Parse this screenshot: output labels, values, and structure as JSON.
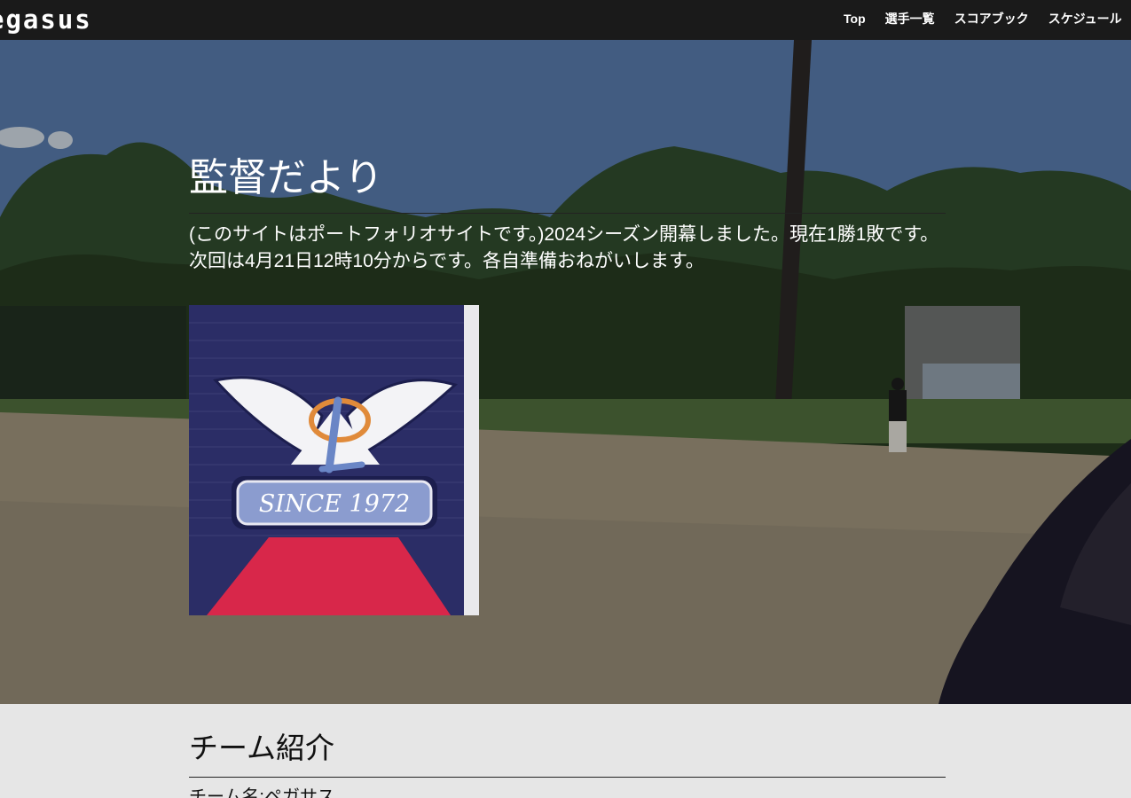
{
  "header": {
    "logo": "egasus",
    "nav": [
      "Top",
      "選手一覧",
      "スコアブック",
      "スケジュール"
    ]
  },
  "hero": {
    "title": "監督だより",
    "text": "(このサイトはポートフォリオサイトです。)2024シーズン開幕しました。現在1勝1敗です。次回は4月21日12時10分からです。各自準備おねがいします。",
    "patch_text": "SINCE 1972",
    "patch_letter": "P"
  },
  "team": {
    "title": "チーム紹介",
    "name_line": "チーム名:ペガサス"
  },
  "colors": {
    "header_bg": "#1a1a1a",
    "section_bg": "#e6e6e6",
    "patch_navy": "#2b2d66",
    "patch_red": "#d8274a"
  }
}
